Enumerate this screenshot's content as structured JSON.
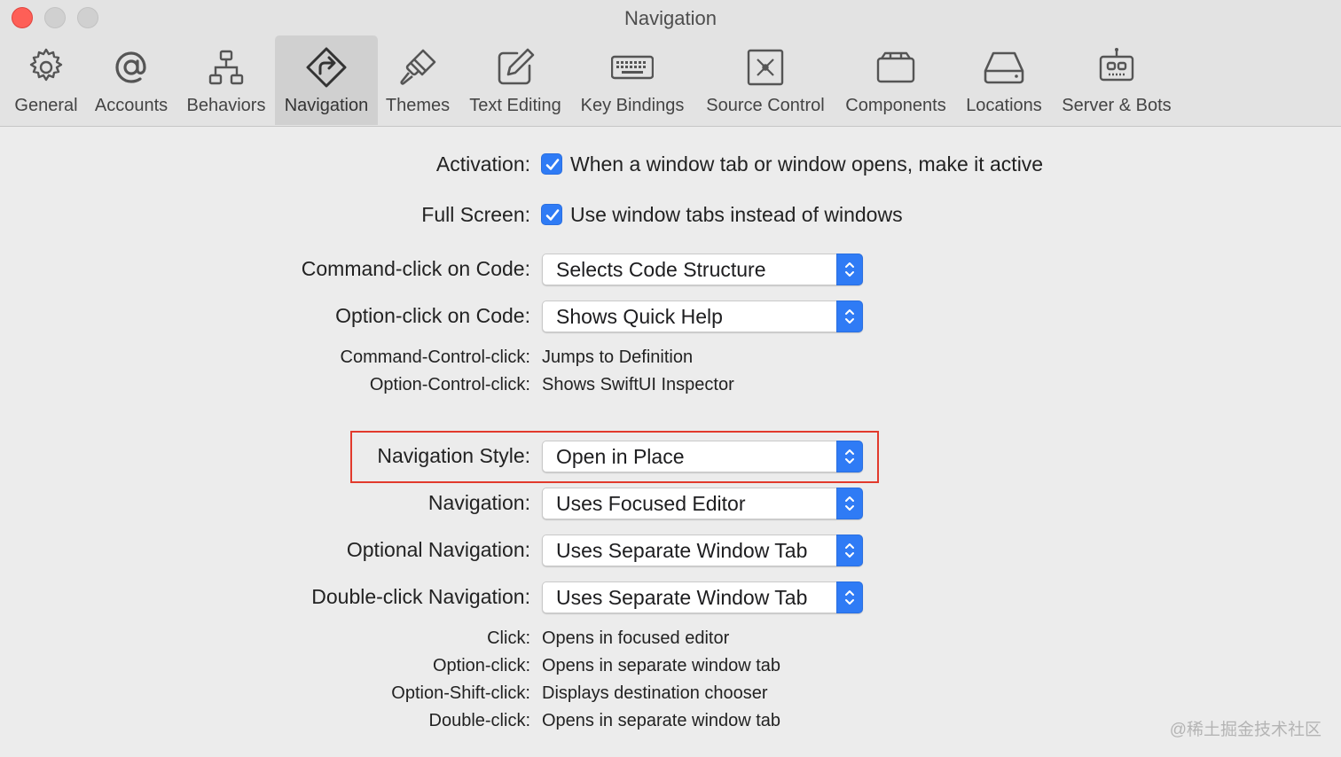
{
  "window": {
    "title": "Navigation"
  },
  "toolbar": {
    "items": [
      {
        "label": "General",
        "icon": "gear-icon"
      },
      {
        "label": "Accounts",
        "icon": "at-sign-icon"
      },
      {
        "label": "Behaviors",
        "icon": "hierarchy-icon"
      },
      {
        "label": "Navigation",
        "icon": "navigation-diamond-icon",
        "selected": true
      },
      {
        "label": "Themes",
        "icon": "paintbrush-icon"
      },
      {
        "label": "Text Editing",
        "icon": "pencil-square-icon"
      },
      {
        "label": "Key Bindings",
        "icon": "keyboard-icon"
      },
      {
        "label": "Source Control",
        "icon": "source-control-icon"
      },
      {
        "label": "Components",
        "icon": "box-icon"
      },
      {
        "label": "Locations",
        "icon": "disk-drive-icon"
      },
      {
        "label": "Server & Bots",
        "icon": "robot-icon"
      }
    ]
  },
  "settings": {
    "activation": {
      "label": "Activation:",
      "checked": true,
      "text": "When a window tab or window opens, make it active"
    },
    "full_screen": {
      "label": "Full Screen:",
      "checked": true,
      "text": "Use window tabs instead of windows"
    },
    "command_click": {
      "label": "Command-click on Code:",
      "value": "Selects Code Structure"
    },
    "option_click": {
      "label": "Option-click on Code:",
      "value": "Shows Quick Help"
    },
    "command_control_click": {
      "label": "Command-Control-click:",
      "value": "Jumps to Definition"
    },
    "option_control_click": {
      "label": "Option-Control-click:",
      "value": "Shows SwiftUI Inspector"
    },
    "navigation_style": {
      "label": "Navigation Style:",
      "value": "Open in Place"
    },
    "navigation": {
      "label": "Navigation:",
      "value": "Uses Focused Editor"
    },
    "optional_navigation": {
      "label": "Optional Navigation:",
      "value": "Uses Separate Window Tab"
    },
    "double_click_navigation": {
      "label": "Double-click Navigation:",
      "value": "Uses Separate Window Tab"
    },
    "click": {
      "label": "Click:",
      "value": "Opens in focused editor"
    },
    "option_click_info": {
      "label": "Option-click:",
      "value": "Opens in separate window tab"
    },
    "option_shift_click": {
      "label": "Option-Shift-click:",
      "value": "Displays destination chooser"
    },
    "double_click": {
      "label": "Double-click:",
      "value": "Opens in separate window tab"
    }
  },
  "watermark": "@稀土掘金技术社区",
  "colors": {
    "accent": "#2f7bf5",
    "highlight": "#e23a2c",
    "close_button": "#fe5f57"
  }
}
